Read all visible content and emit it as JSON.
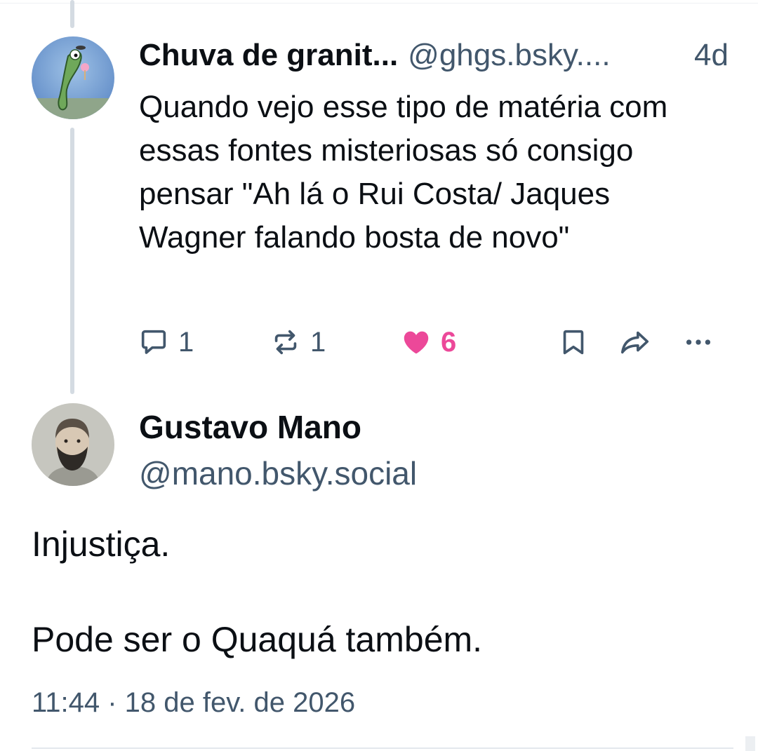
{
  "parent_post": {
    "display_name": "Chuva de granit...",
    "handle": "@ghgs.bsky....",
    "time_ago": "4d",
    "text": "Quando vejo esse tipo de matéria com essas fontes misteriosas só consigo pensar \"Ah lá o Rui Costa/ Jaques Wagner falando bosta de novo\"",
    "avatar_icon": "cartoon-avatar",
    "actions": {
      "reply": {
        "icon": "reply-icon",
        "count": "1"
      },
      "repost": {
        "icon": "repost-icon",
        "count": "1"
      },
      "like": {
        "icon": "heart-icon",
        "count": "6",
        "liked": true,
        "color": "#ec4899"
      },
      "bookmark": {
        "icon": "bookmark-icon"
      },
      "share": {
        "icon": "share-icon"
      },
      "more": {
        "icon": "more-icon"
      }
    }
  },
  "main_post": {
    "display_name": "Gustavo Mano",
    "handle": "@mano.bsky.social",
    "avatar_icon": "profile-photo-avatar",
    "paragraphs": [
      "Injustiça.",
      "Pode ser o Quaquá também."
    ],
    "timestamp": "11:44 · 18 de fev. de 2026"
  },
  "colors": {
    "text": "#0b0f14",
    "muted": "#42576c",
    "like": "#ec4899",
    "thread_line": "#d4dbe2"
  }
}
